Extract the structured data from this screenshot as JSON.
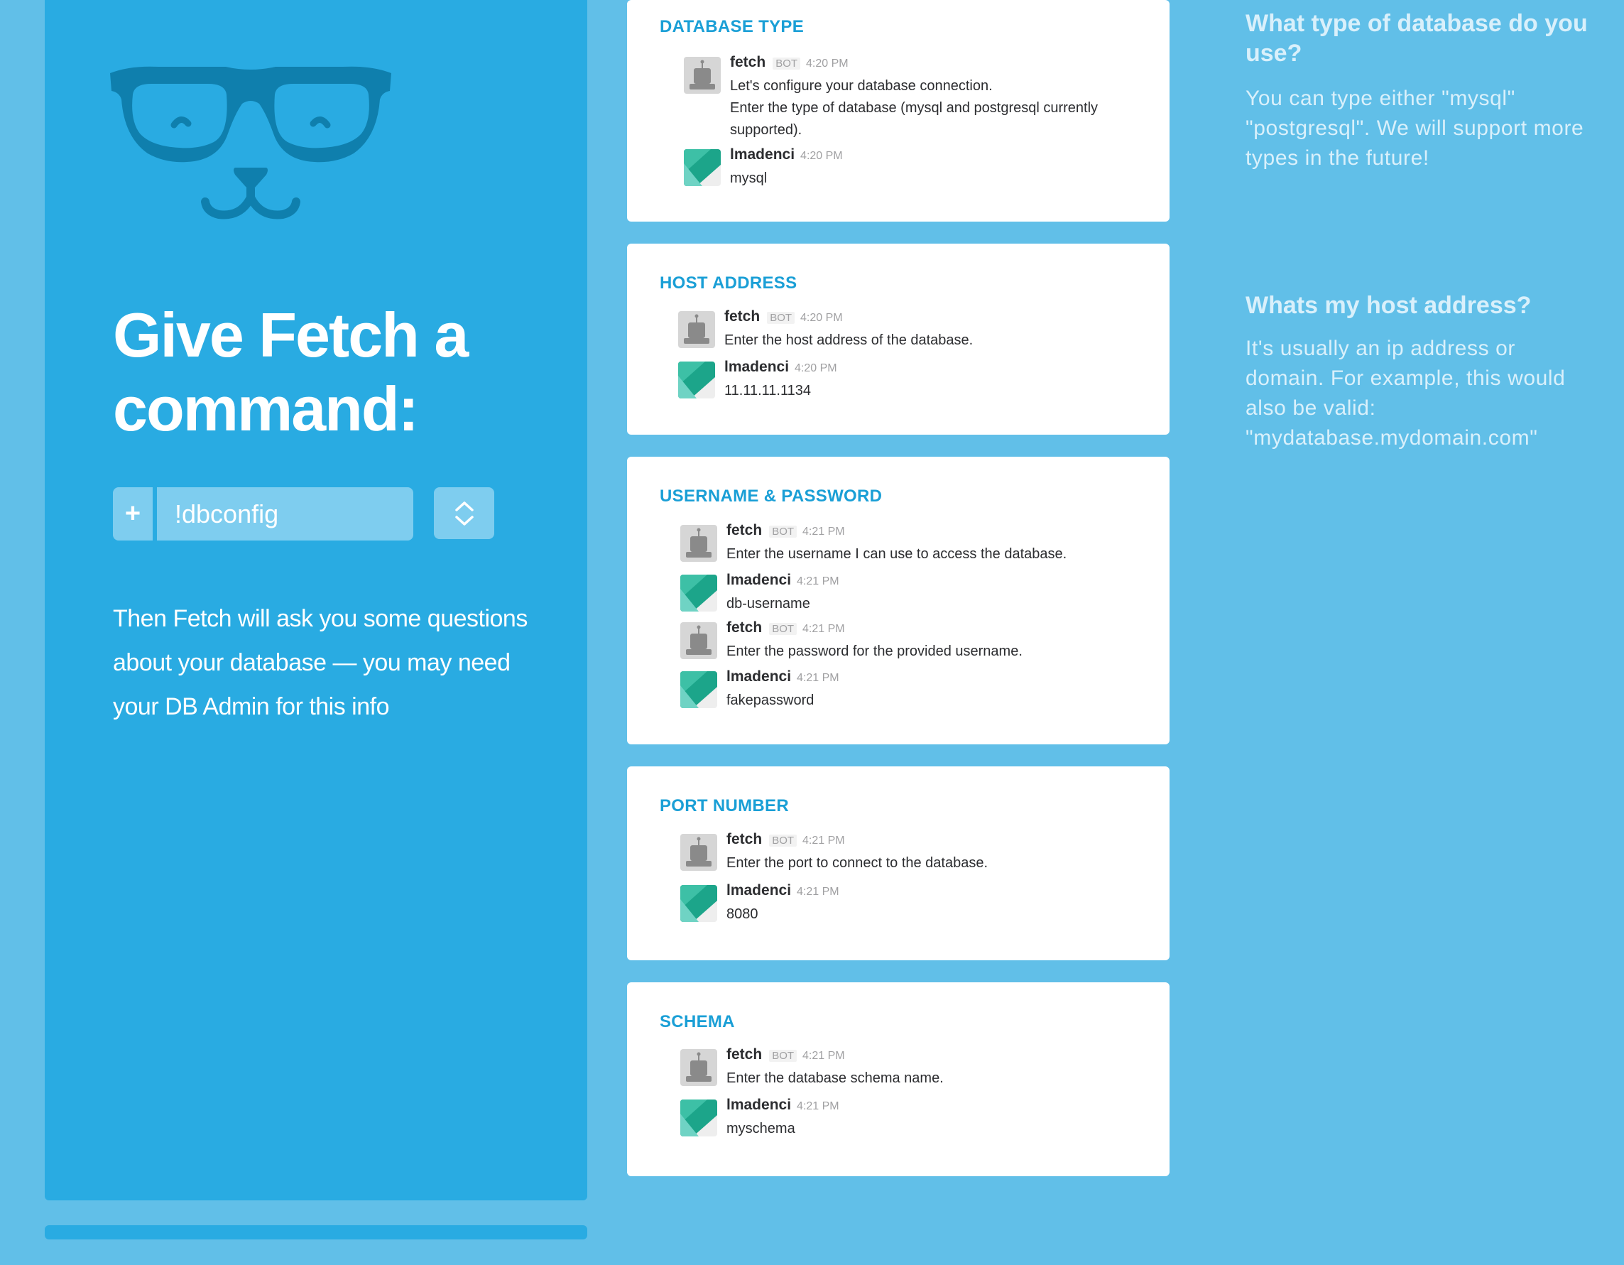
{
  "promo": {
    "headline": "Give Fetch a command:",
    "command_value": "!dbconfig",
    "plus_icon": "+",
    "description": "Then Fetch will ask you some questions about your database — you may need your DB Admin for this info"
  },
  "sections": [
    {
      "title": "DATABASE TYPE",
      "messages": [
        {
          "author": "fetch",
          "bot": "BOT",
          "time": "4:20 PM",
          "avatar": "robot-avatar",
          "text": "Let's configure your database connection.\nEnter the type of database (mysql and postgresql currently supported)."
        },
        {
          "author": "lmadenci",
          "time": "4:20 PM",
          "avatar": "user-avatar",
          "text": "mysql"
        }
      ]
    },
    {
      "title": "HOST ADDRESS",
      "messages": [
        {
          "author": "fetch",
          "bot": "BOT",
          "time": "4:20 PM",
          "avatar": "robot-avatar",
          "text": "Enter the host address of the database."
        },
        {
          "author": "lmadenci",
          "time": "4:20 PM",
          "avatar": "user-avatar",
          "text": "11.11.11.1134"
        }
      ]
    },
    {
      "title": "USERNAME & PASSWORD",
      "messages": [
        {
          "author": "fetch",
          "bot": "BOT",
          "time": "4:21 PM",
          "avatar": "robot-avatar",
          "text": "Enter the username I can use to access the database."
        },
        {
          "author": "lmadenci",
          "time": "4:21 PM",
          "avatar": "user-avatar",
          "text": "db-username"
        },
        {
          "author": "fetch",
          "bot": "BOT",
          "time": "4:21 PM",
          "avatar": "robot-avatar",
          "text": "Enter the password for the provided username."
        },
        {
          "author": "lmadenci",
          "time": "4:21 PM",
          "avatar": "user-avatar",
          "text": "fakepassword"
        }
      ]
    },
    {
      "title": "PORT NUMBER",
      "messages": [
        {
          "author": "fetch",
          "bot": "BOT",
          "time": "4:21 PM",
          "avatar": "robot-avatar",
          "text": "Enter the port to connect to the database."
        },
        {
          "author": "lmadenci",
          "time": "4:21 PM",
          "avatar": "user-avatar",
          "text": "8080"
        }
      ]
    },
    {
      "title": "SCHEMA",
      "messages": [
        {
          "author": "fetch",
          "bot": "BOT",
          "time": "4:21 PM",
          "avatar": "robot-avatar",
          "text": "Enter the database schema name."
        },
        {
          "author": "lmadenci",
          "time": "4:21 PM",
          "avatar": "user-avatar",
          "text": "myschema"
        }
      ]
    }
  ],
  "help": [
    {
      "question": "What type of database do you use?",
      "answer": "You can type either \"mysql\" \"postgresql\". We will support more types in the future!"
    },
    {
      "question": "Whats my host address?",
      "answer": "It's usually an ip address or domain. For example, this would also be valid: \"mydatabase.mydomain.com\""
    }
  ],
  "colors": {
    "background": "#61bfe8",
    "panel": "#29abe2",
    "section_title": "#1a9fd6",
    "mascot": "#0f7fad"
  }
}
